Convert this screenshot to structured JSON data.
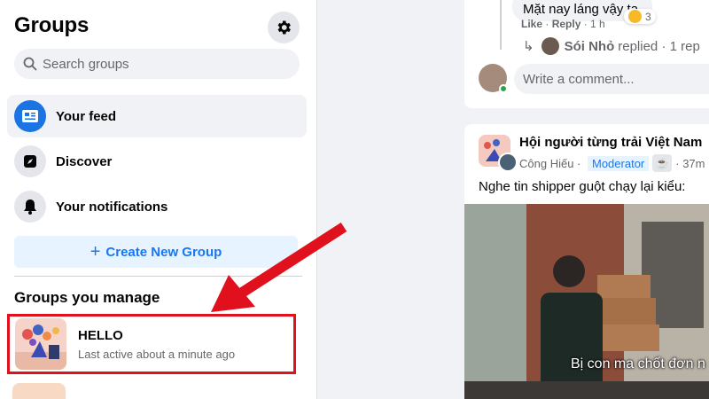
{
  "sidebar": {
    "title": "Groups",
    "search_placeholder": "Search groups",
    "nav": [
      {
        "label": "Your feed"
      },
      {
        "label": "Discover"
      },
      {
        "label": "Your notifications"
      }
    ],
    "create_label": "Create New Group",
    "section_title": "Groups you manage",
    "groups": [
      {
        "name": "HELLO",
        "meta": "Last active about a minute ago"
      }
    ]
  },
  "feed": {
    "comment_text": "Mặt nay láng vậy ta",
    "comment_like": "Like",
    "comment_reply": "Reply",
    "comment_time": "1 h",
    "reaction_count": "3",
    "replied_name": "Sói Nhỏ",
    "replied_text": "replied",
    "replied_count": "· 1 rep",
    "write_placeholder": "Write a comment...",
    "post": {
      "group": "Hội người từng trải Việt Nam",
      "author": "Công Hiếu",
      "badge": "Moderator",
      "time": "37m",
      "text": "Nghe tin shipper guột chạy lại kiểu:",
      "caption": "Bị con ma chốt đơn n"
    }
  },
  "colors": {
    "accent": "#1877f2",
    "highlight": "#e0101d"
  }
}
